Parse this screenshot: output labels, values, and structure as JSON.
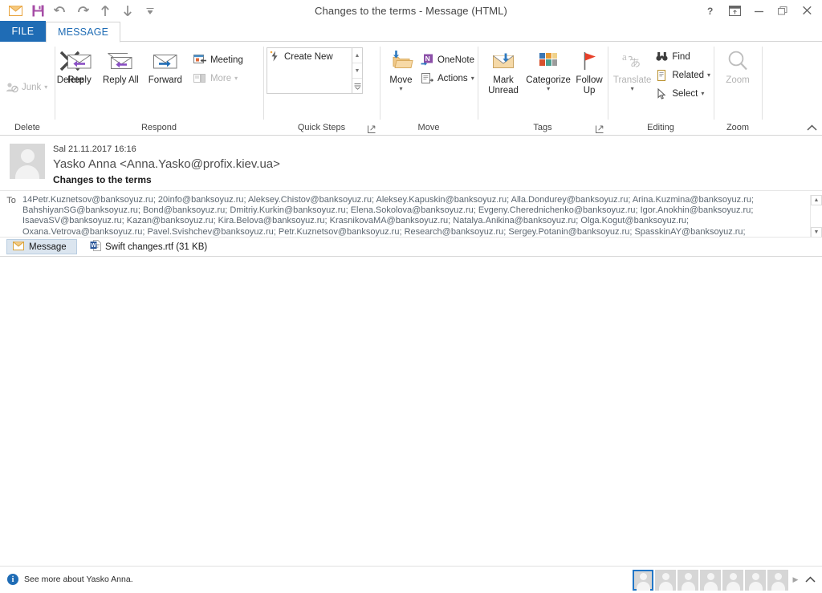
{
  "window": {
    "title": "Changes to the terms - Message (HTML)",
    "quick_access": [
      {
        "name": "mail-icon",
        "label": "Mail"
      },
      {
        "name": "save-icon",
        "label": "Save"
      },
      {
        "name": "undo-icon",
        "label": "Undo"
      },
      {
        "name": "redo-icon",
        "label": "Redo"
      },
      {
        "name": "previous-item-icon",
        "label": "Previous Item"
      },
      {
        "name": "next-item-icon",
        "label": "Next Item"
      },
      {
        "name": "customize-quick-access-toolbar-icon",
        "label": "Customize Quick Access Toolbar"
      }
    ],
    "controls": [
      {
        "name": "help-button",
        "glyph": "?"
      },
      {
        "name": "ribbon-display-options-button",
        "glyph": "ribbon"
      },
      {
        "name": "minimize-button",
        "glyph": "minimize"
      },
      {
        "name": "restore-button",
        "glyph": "restore"
      },
      {
        "name": "close-button",
        "glyph": "close"
      }
    ]
  },
  "tabs": {
    "file": "FILE",
    "message": "MESSAGE"
  },
  "ribbon": {
    "collapse_label": "^",
    "groups": [
      {
        "name": "delete",
        "label": "Delete",
        "buttons": [
          {
            "label": "Junk",
            "icon": "junk-icon",
            "disabled": true,
            "dropdown": true
          },
          {
            "label": "Delete",
            "icon": "delete-x-icon",
            "disabled": false,
            "dropdown": false
          }
        ]
      },
      {
        "name": "respond",
        "label": "Respond",
        "buttons": [
          {
            "label": "Reply",
            "icon": "reply-icon",
            "disabled": false,
            "dropdown": false
          },
          {
            "label": "Reply All",
            "icon": "reply-all-icon",
            "disabled": false,
            "dropdown": false
          },
          {
            "label": "Forward",
            "icon": "forward-icon",
            "disabled": false,
            "dropdown": false
          },
          {
            "label": "Meeting",
            "icon": "meeting-icon",
            "disabled": false,
            "dropdown": false
          },
          {
            "label": "More",
            "icon": "more-icon",
            "disabled": true,
            "dropdown": true
          }
        ]
      },
      {
        "name": "quick-steps",
        "label": "Quick Steps",
        "gallery_item": "Create New",
        "has_dialog_launcher": true
      },
      {
        "name": "move",
        "label": "Move",
        "buttons": [
          {
            "label": "Move",
            "icon": "move-folder-icon",
            "disabled": false,
            "dropdown": true
          },
          {
            "label": "OneNote",
            "icon": "onenote-icon",
            "disabled": false,
            "dropdown": false
          },
          {
            "label": "Actions",
            "icon": "actions-icon",
            "disabled": false,
            "dropdown": true
          }
        ]
      },
      {
        "name": "tags",
        "label": "Tags",
        "has_dialog_launcher": true,
        "buttons": [
          {
            "label": "Mark Unread",
            "icon": "mark-unread-icon",
            "disabled": false,
            "dropdown": false
          },
          {
            "label": "Categorize",
            "icon": "categorize-icon",
            "disabled": false,
            "dropdown": true
          },
          {
            "label": "Follow Up",
            "icon": "follow-up-flag-icon",
            "disabled": false,
            "dropdown": true
          }
        ]
      },
      {
        "name": "editing",
        "label": "Editing",
        "buttons": [
          {
            "label": "Translate",
            "icon": "translate-icon",
            "disabled": true,
            "dropdown": true
          },
          {
            "label": "Find",
            "icon": "find-binoculars-icon",
            "disabled": false,
            "dropdown": false
          },
          {
            "label": "Related",
            "icon": "related-icon",
            "disabled": false,
            "dropdown": true
          },
          {
            "label": "Select",
            "icon": "select-cursor-icon",
            "disabled": false,
            "dropdown": true
          }
        ]
      },
      {
        "name": "zoom",
        "label": "Zoom",
        "buttons": [
          {
            "label": "Zoom",
            "icon": "zoom-magnifier-icon",
            "disabled": true,
            "dropdown": false
          }
        ]
      }
    ]
  },
  "message": {
    "date": "Sal 21.11.2017 16:16",
    "from": "Yasko Anna <Anna.Yasko@profix.kiev.ua>",
    "subject": "Changes to the terms",
    "to_label": "To",
    "recipients_lines": [
      "14Petr.Kuznetsov@banksoyuz.ru; 20info@banksoyuz.ru; Aleksey.Chistov@banksoyuz.ru; Aleksey.Kapuskin@banksoyuz.ru; Alla.Dondurey@banksoyuz.ru; Arina.Kuzmina@banksoyuz.ru;",
      "BahshiyanSG@banksoyuz.ru; Bond@banksoyuz.ru; Dmitriy.Kurkin@banksoyuz.ru; Elena.Sokolova@banksoyuz.ru; Evgeny.Cherednichenko@banksoyuz.ru; Igor.Anokhin@banksoyuz.ru;",
      "IsaevaSV@banksoyuz.ru; Kazan@banksoyuz.ru; Kira.Belova@banksoyuz.ru; KrasnikovaMA@banksoyuz.ru; Natalya.Anikina@banksoyuz.ru; Olga.Kogut@banksoyuz.ru;",
      "Oxana.Vetrova@banksoyuz.ru; Pavel.Svishchev@banksoyuz.ru; Petr.Kuznetsov@banksoyuz.ru; Research@banksoyuz.ru; Sergey.Potanin@banksoyuz.ru; SpasskinAY@banksoyuz.ru;"
    ],
    "body_text": ""
  },
  "attachment_bar": {
    "message_tab": "Message",
    "attachment": "Swift changes.rtf (31 KB)"
  },
  "status_bar": {
    "info_text": "See more about Yasko Anna.",
    "info_glyph": "i",
    "people_count": 7,
    "selected_person_index": 0
  },
  "colors": {
    "accent_blue": "#1f6cb5",
    "tab_selected_text": "#1f6cb5",
    "recipient_text": "#5b6670",
    "attachment_tab_bg": "#dbe5ef",
    "flag_red": "#e8402a"
  }
}
